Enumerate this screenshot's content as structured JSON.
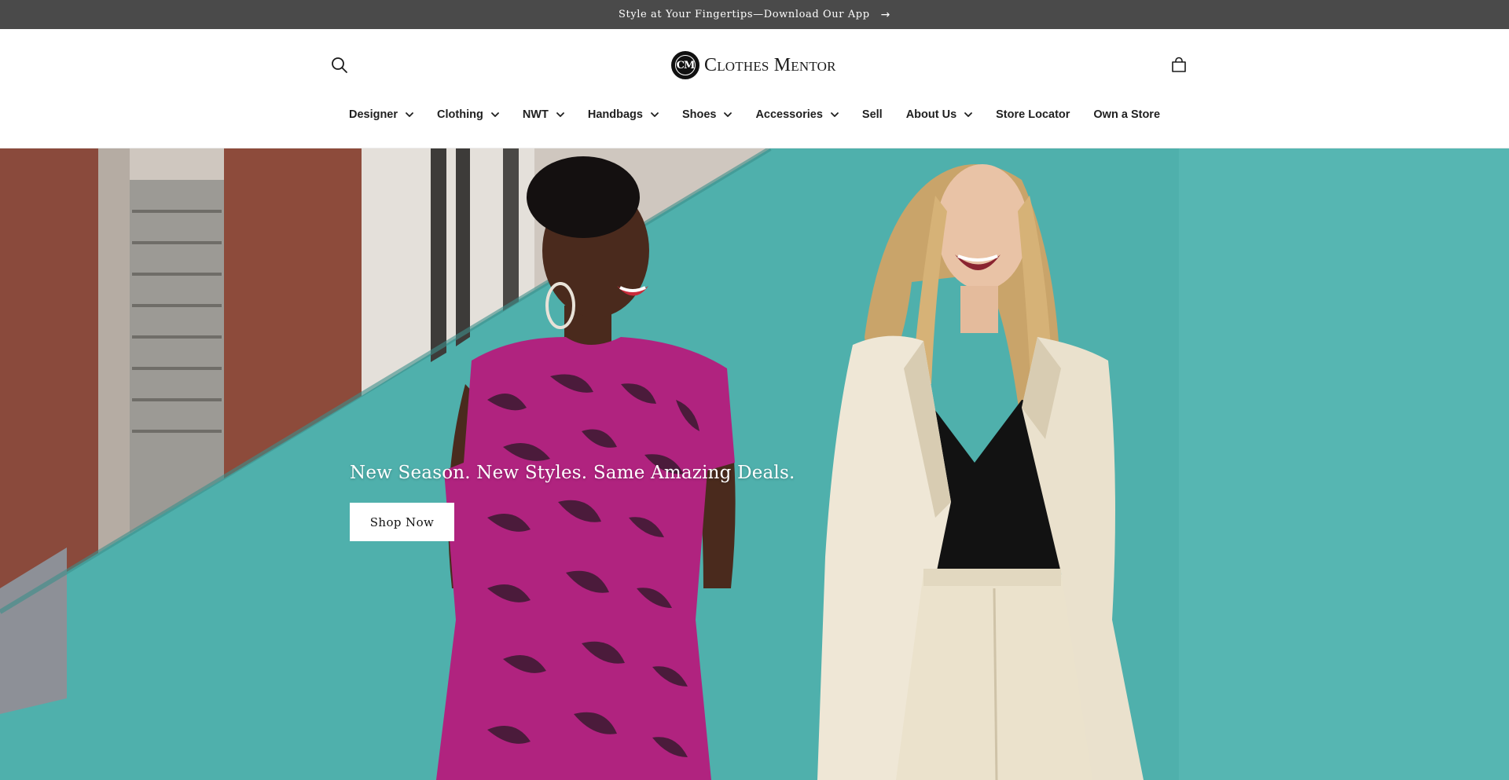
{
  "announcement": {
    "text": "Style at Your Fingertips—Download Our App",
    "arrow": "→"
  },
  "header": {
    "logo_text": "Clothes Mentor",
    "logo_mark": "CM",
    "search_icon": "search-icon",
    "cart_icon": "shopping-bag-icon"
  },
  "nav": {
    "items": [
      {
        "label": "Designer",
        "dropdown": true
      },
      {
        "label": "Clothing",
        "dropdown": true
      },
      {
        "label": "NWT",
        "dropdown": true
      },
      {
        "label": "Handbags",
        "dropdown": true
      },
      {
        "label": "Shoes",
        "dropdown": true
      },
      {
        "label": "Accessories",
        "dropdown": true
      },
      {
        "label": "Sell",
        "dropdown": false
      },
      {
        "label": "About Us",
        "dropdown": true
      },
      {
        "label": "Store Locator",
        "dropdown": false
      },
      {
        "label": "Own a Store",
        "dropdown": false
      }
    ]
  },
  "hero": {
    "heading": "New Season. New Styles. Same Amazing Deals.",
    "cta_label": "Shop Now"
  },
  "colors": {
    "announcement_bg": "#4a4a4a",
    "wall_teal": "#4fb0ac",
    "dress_magenta": "#b0237f",
    "blazer_cream": "#efe7d6"
  }
}
